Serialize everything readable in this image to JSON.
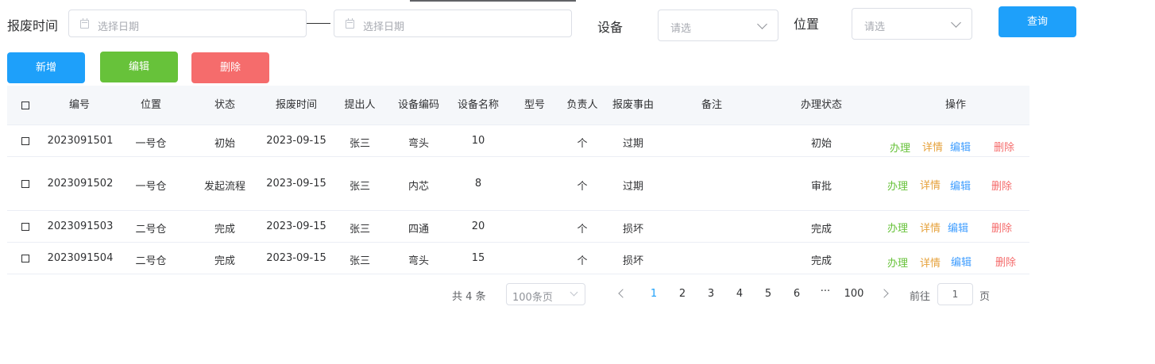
{
  "filters": {
    "scrap_time_label": "报废时间",
    "date_start_placeholder": "选择日期",
    "range_separator": "—",
    "date_end_placeholder": "选择日期",
    "device_label": "设备",
    "device_placeholder": "请选",
    "location_label": "位置",
    "location_placeholder": "请选",
    "query_button": "查询"
  },
  "toolbar": {
    "add_button": "新增",
    "edit_button": "编辑",
    "delete_button": "删除"
  },
  "table": {
    "headers": [
      "编号",
      "位置",
      "状态",
      "报废时间",
      "提出人",
      "设备编码",
      "设备名称",
      "型号",
      "负责人",
      "报废事由",
      "备注",
      "办理状态",
      "操作"
    ],
    "rows": [
      {
        "id": "2023091501",
        "location": "一号仓",
        "status": "初始",
        "time": "2023-09-15",
        "proposer": "张三",
        "code": "弯头",
        "name": "10",
        "model": "",
        "owner": "个",
        "reason": "过期",
        "remark": "",
        "handle_status": "初始"
      },
      {
        "id": "2023091502",
        "location": "一号仓",
        "status": "发起流程",
        "time": "2023-09-15",
        "proposer": "张三",
        "code": "内芯",
        "name": "8",
        "model": "",
        "owner": "个",
        "reason": "过期",
        "remark": "",
        "handle_status": "审批"
      },
      {
        "id": "2023091503",
        "location": "二号仓",
        "status": "完成",
        "time": "2023-09-15",
        "proposer": "张三",
        "code": "四通",
        "name": "20",
        "model": "",
        "owner": "个",
        "reason": "损坏",
        "remark": "",
        "handle_status": "完成"
      },
      {
        "id": "2023091504",
        "location": "二号仓",
        "status": "完成",
        "time": "2023-09-15",
        "proposer": "张三",
        "code": "弯头",
        "name": "15",
        "model": "",
        "owner": "个",
        "reason": "损坏",
        "remark": "",
        "handle_status": "完成"
      }
    ],
    "actions": {
      "handle": "办理",
      "detail": "详情",
      "edit": "编辑",
      "delete": "删除"
    }
  },
  "pagination": {
    "total_prefix": "共",
    "total": "4",
    "total_suffix": "条",
    "page_size": "100条页",
    "pages": [
      "1",
      "2",
      "3",
      "4",
      "5",
      "6"
    ],
    "ellipsis": "···",
    "last_page": "100",
    "current_page": "1",
    "goto_label": "前往",
    "goto_value": "1",
    "goto_suffix": "页"
  },
  "colors": {
    "primary": "#1ea0fa",
    "success": "#67c23a",
    "danger": "#f56c6c",
    "warning": "#e6a23c",
    "header_bg": "#f5f7fa",
    "edit_link": "#409eff"
  }
}
